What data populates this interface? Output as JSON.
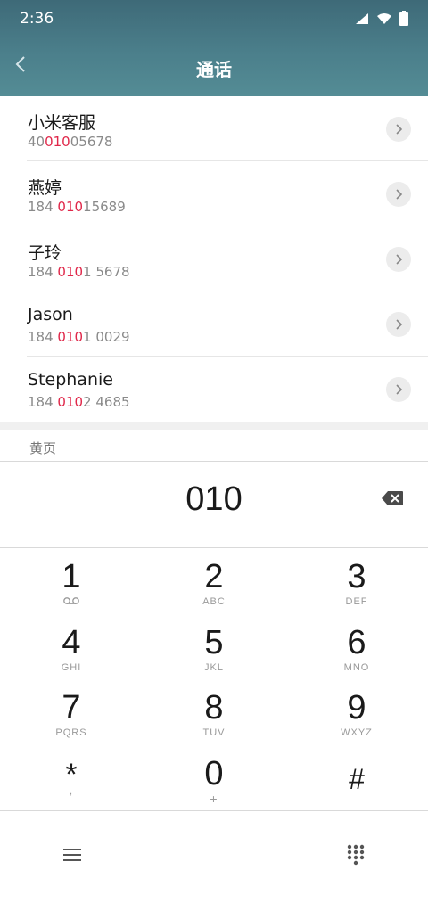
{
  "status_bar": {
    "time": "2:36"
  },
  "header": {
    "title": "通话"
  },
  "contacts": [
    {
      "name": "小米客服",
      "number_pre": "40",
      "number_match": "010",
      "number_post": "05678"
    },
    {
      "name": "燕婷",
      "number_pre": "184 ",
      "number_match": "010",
      "number_post": "15689"
    },
    {
      "name": "子玲",
      "number_pre": "184 ",
      "number_match": "010",
      "number_post": "1 5678"
    },
    {
      "name": "Jason",
      "number_pre": "184 ",
      "number_match": "010",
      "number_post": "1 0029"
    },
    {
      "name": "Stephanie",
      "number_pre": "184 ",
      "number_match": "010",
      "number_post": "2 4685"
    }
  ],
  "section_label": "黄页",
  "dialer": {
    "number": "010"
  },
  "keypad": [
    {
      "digit": "1",
      "letters": ""
    },
    {
      "digit": "2",
      "letters": "ABC"
    },
    {
      "digit": "3",
      "letters": "DEF"
    },
    {
      "digit": "4",
      "letters": "GHI"
    },
    {
      "digit": "5",
      "letters": "JKL"
    },
    {
      "digit": "6",
      "letters": "MNO"
    },
    {
      "digit": "7",
      "letters": "PQRS"
    },
    {
      "digit": "8",
      "letters": "TUV"
    },
    {
      "digit": "9",
      "letters": "WXYZ"
    },
    {
      "digit": "*",
      "letters": ","
    },
    {
      "digit": "0",
      "letters": "+"
    },
    {
      "digit": "#",
      "letters": ""
    }
  ],
  "icons": {
    "back": "chevron-left-icon",
    "detail": "chevron-right-icon",
    "backspace": "backspace-icon",
    "voicemail": "voicemail-icon",
    "menu": "menu-icon",
    "keypad": "dialpad-icon",
    "signal": "signal-icon",
    "wifi": "wifi-icon",
    "battery": "battery-icon"
  },
  "colors": {
    "header": "#4b7f8b",
    "match_highlight": "#e0284a"
  }
}
